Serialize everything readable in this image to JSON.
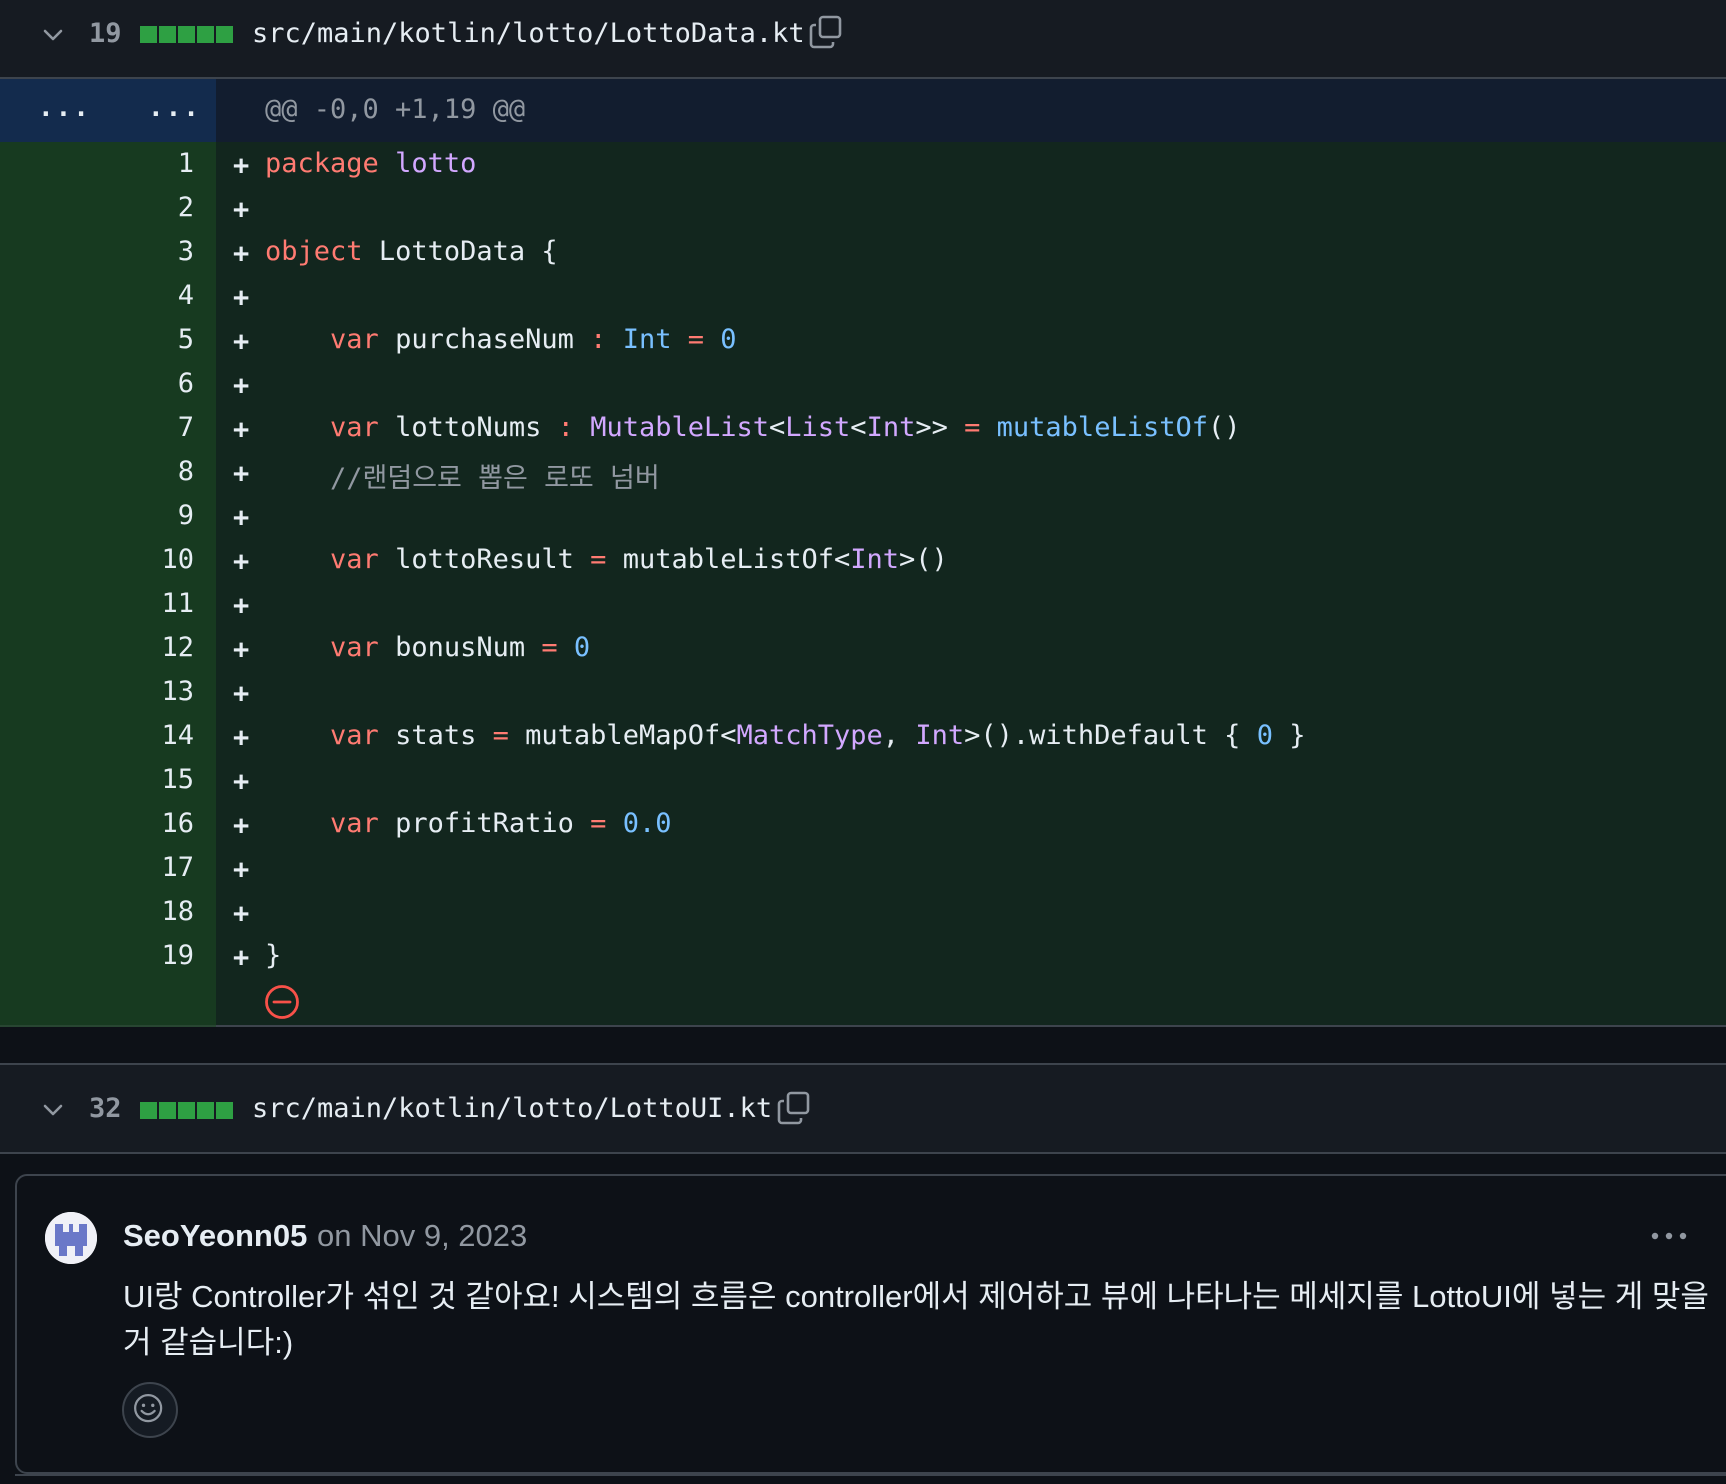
{
  "files": [
    {
      "changes": "19",
      "path": "src/main/kotlin/lotto/LottoData.kt"
    },
    {
      "changes": "32",
      "path": "src/main/kotlin/lotto/LottoUI.kt"
    }
  ],
  "hunk": {
    "old_dots": "...",
    "new_dots": "...",
    "header": "@@ -0,0 +1,19 @@"
  },
  "diff_lines": [
    {
      "num": "1",
      "sign": "+"
    },
    {
      "num": "2",
      "sign": "+"
    },
    {
      "num": "3",
      "sign": "+"
    },
    {
      "num": "4",
      "sign": "+"
    },
    {
      "num": "5",
      "sign": "+"
    },
    {
      "num": "6",
      "sign": "+"
    },
    {
      "num": "7",
      "sign": "+"
    },
    {
      "num": "8",
      "sign": "+"
    },
    {
      "num": "9",
      "sign": "+"
    },
    {
      "num": "10",
      "sign": "+"
    },
    {
      "num": "11",
      "sign": "+"
    },
    {
      "num": "12",
      "sign": "+"
    },
    {
      "num": "13",
      "sign": "+"
    },
    {
      "num": "14",
      "sign": "+"
    },
    {
      "num": "15",
      "sign": "+"
    },
    {
      "num": "16",
      "sign": "+"
    },
    {
      "num": "17",
      "sign": "+"
    },
    {
      "num": "18",
      "sign": "+"
    },
    {
      "num": "19",
      "sign": "+"
    }
  ],
  "code": {
    "l1": [
      "package",
      "lotto"
    ],
    "l3": [
      "object",
      "LottoData {"
    ],
    "l5": [
      "var",
      "purchaseNum",
      ":",
      "Int",
      "=",
      "0"
    ],
    "l7": [
      "var",
      "lottoNums",
      ":",
      "MutableList",
      "<",
      "List",
      "<",
      "Int",
      ">>",
      "=",
      "mutableListOf",
      "()"
    ],
    "l8": [
      "//랜덤으로 뽑은 로또 넘버"
    ],
    "l10": [
      "var",
      "lottoResult",
      "=",
      "mutableListOf<",
      "Int",
      ">()"
    ],
    "l12": [
      "var",
      "bonusNum",
      "=",
      "0"
    ],
    "l14": [
      "var",
      "stats",
      "=",
      "mutableMapOf<",
      "MatchType",
      ", ",
      "Int",
      ">().withDefault { ",
      "0",
      " }"
    ],
    "l16": [
      "var",
      "profitRatio",
      "=",
      "0.0"
    ],
    "l19": [
      "}"
    ]
  },
  "comment": {
    "author": "SeoYeonn05",
    "timestamp": "on Nov 9, 2023",
    "body": "UI랑 Controller가 섞인 것 같아요! 시스템의 흐름은 controller에서 제어하고 뷰에 나타나는 메세지를 LottoUI에 넣는 게 맞을 거 같습니다:)"
  },
  "colors": {
    "background": "#0d1117",
    "added_gutter": "#1b4721",
    "added_code_bg": "#12261e",
    "hunk_bg": "#121d2f",
    "hunk_gutter": "#132b4d",
    "diffstat_green": "#2ea043",
    "keyword": "#ff7b72",
    "type": "#d2a8ff",
    "number": "#79c0ff",
    "comment_text": "#9198a1"
  },
  "icons": [
    "chevron-down-icon",
    "copy-icon",
    "collapse-minus-icon",
    "kebab-icon",
    "smiley-icon",
    "avatar"
  ]
}
